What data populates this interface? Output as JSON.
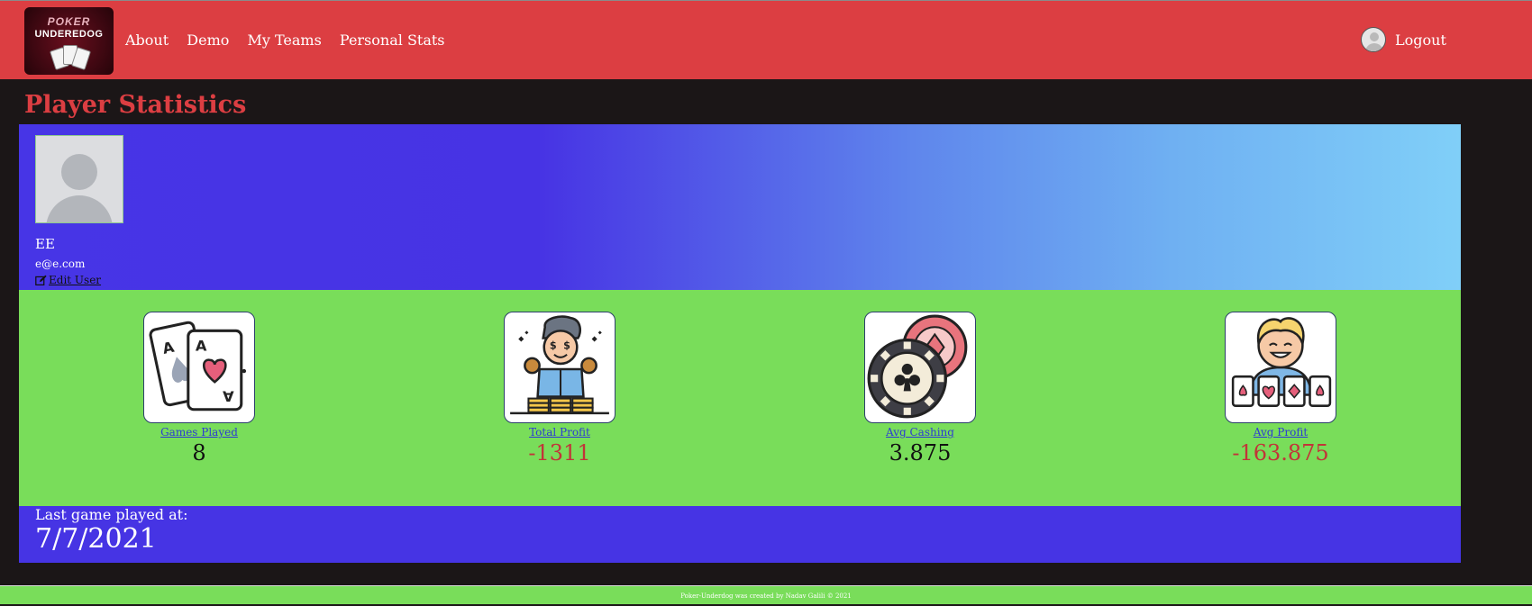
{
  "brand": {
    "line1": "POKER",
    "line2": "UNDEREDOG"
  },
  "nav": {
    "links": [
      "About",
      "Demo",
      "My Teams",
      "Personal Stats"
    ],
    "logout_label": "Logout"
  },
  "page": {
    "title": "Player Statistics"
  },
  "profile": {
    "name": "EE",
    "email": "e@e.com",
    "edit_label": "Edit User"
  },
  "stats": [
    {
      "label": "Games Played",
      "value": "8",
      "icon": "playing-cards-icon",
      "sign": "neutral"
    },
    {
      "label": "Total Profit",
      "value": "-1311",
      "icon": "rich-man-coins-icon",
      "sign": "negative"
    },
    {
      "label": "Avg Cashing",
      "value": "3.875",
      "icon": "poker-chips-icon",
      "sign": "neutral"
    },
    {
      "label": "Avg Profit",
      "value": "-163.875",
      "icon": "player-with-cards-icon",
      "sign": "negative"
    }
  ],
  "last_game": {
    "label": "Last game played at:",
    "date": "7/7/2021"
  },
  "footer": {
    "text": "Poker-Underdog was created by Nadav Galili © 2021"
  },
  "colors": {
    "header": "#dc3e42",
    "stats_bg": "#79dd5a",
    "band_blue": "#4634e4",
    "negative": "#c23438"
  }
}
